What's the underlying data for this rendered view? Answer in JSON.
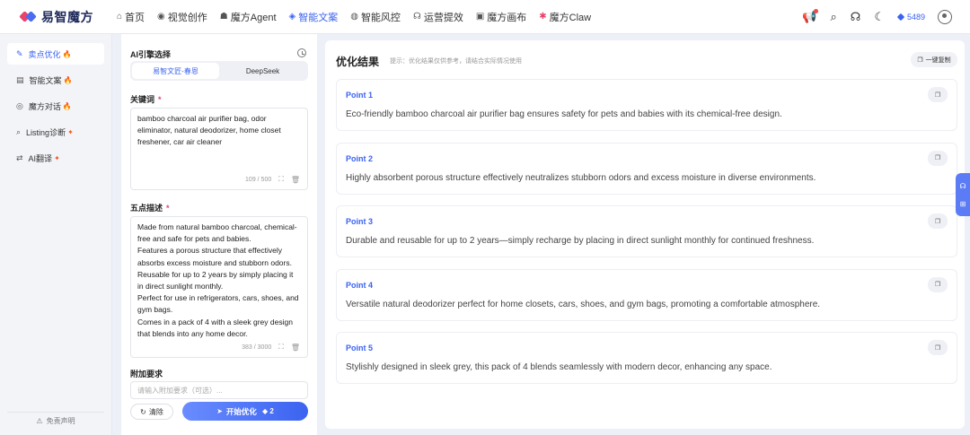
{
  "brand": {
    "name": "易智魔方"
  },
  "nav": [
    {
      "label": "首页",
      "icon": "home-icon",
      "glyph": "⌂",
      "active": false
    },
    {
      "label": "视觉创作",
      "icon": "eye-icon",
      "glyph": "◉",
      "active": false
    },
    {
      "label": "魔方Agent",
      "icon": "robot-icon",
      "glyph": "☗",
      "active": false
    },
    {
      "label": "智能文案",
      "icon": "shield-icon",
      "glyph": "◈",
      "active": true
    },
    {
      "label": "智能风控",
      "icon": "risk-icon",
      "glyph": "◍",
      "active": false
    },
    {
      "label": "运营提效",
      "icon": "headset-icon",
      "glyph": "☊",
      "active": false
    },
    {
      "label": "魔方画布",
      "icon": "canvas-icon",
      "glyph": "▣",
      "active": false
    },
    {
      "label": "魔方Claw",
      "icon": "claw-icon",
      "glyph": "✱",
      "active": false
    }
  ],
  "top_right": {
    "credits": "5489"
  },
  "sidebar": {
    "items": [
      {
        "label": "卖点优化",
        "icon": "edit-icon",
        "glyph": "✎",
        "active": true,
        "hot": "fire"
      },
      {
        "label": "智能文案",
        "icon": "document-icon",
        "glyph": "▤",
        "active": false,
        "hot": "fire"
      },
      {
        "label": "魔方对话",
        "icon": "chat-icon",
        "glyph": "◎",
        "active": false,
        "hot": "fire"
      },
      {
        "label": "Listing诊断",
        "icon": "diagnose-icon",
        "glyph": "⌕",
        "active": false,
        "hot": "sparkle"
      },
      {
        "label": "AI翻译",
        "icon": "translate-icon",
        "glyph": "⇄",
        "active": false,
        "hot": "sparkle"
      }
    ],
    "footer": "免责声明"
  },
  "panel": {
    "engine_title": "AI引擎选择",
    "engines": [
      {
        "label": "易智文匠-春恩",
        "active": true
      },
      {
        "label": "DeepSeek",
        "active": false
      }
    ],
    "keywords_label": "关键词",
    "keywords_value": "bamboo charcoal air purifier bag, odor eliminator, natural deodorizer, home closet freshener, car air cleaner",
    "keywords_count": "109 / 500",
    "bullets_label": "五点描述",
    "bullets_value": "Made from natural bamboo charcoal, chemical-free and safe for pets and babies.\nFeatures a porous structure that effectively absorbs excess moisture and stubborn odors.\nReusable for up to 2 years by simply placing it in direct sunlight monthly.\nPerfect for use in refrigerators, cars, shoes, and gym bags.\nComes in a pack of 4 with a sleek grey design that blends into any home decor.",
    "bullets_count": "383 / 3000",
    "extra_label": "附加要求",
    "extra_placeholder": "请输入附加要求（可选）...",
    "clear_label": "清除",
    "start_label": "开始优化",
    "start_cost": "2"
  },
  "results": {
    "title": "优化结果",
    "hint": "提示：优化结果仅供参考，请结合实际情况使用",
    "copy_all": "一键复制",
    "points": [
      {
        "label": "Point 1",
        "text": "Eco-friendly bamboo charcoal air purifier bag ensures safety for pets and babies with its chemical-free design."
      },
      {
        "label": "Point 2",
        "text": "Highly absorbent porous structure effectively neutralizes stubborn odors and excess moisture in diverse environments."
      },
      {
        "label": "Point 3",
        "text": "Durable and reusable for up to 2 years—simply recharge by placing in direct sunlight monthly for continued freshness."
      },
      {
        "label": "Point 4",
        "text": "Versatile natural deodorizer perfect for home closets, cars, shoes, and gym bags, promoting a comfortable atmosphere."
      },
      {
        "label": "Point 5",
        "text": "Stylishly designed in sleek grey, this pack of 4 blends seamlessly with modern decor, enhancing any space."
      }
    ]
  }
}
